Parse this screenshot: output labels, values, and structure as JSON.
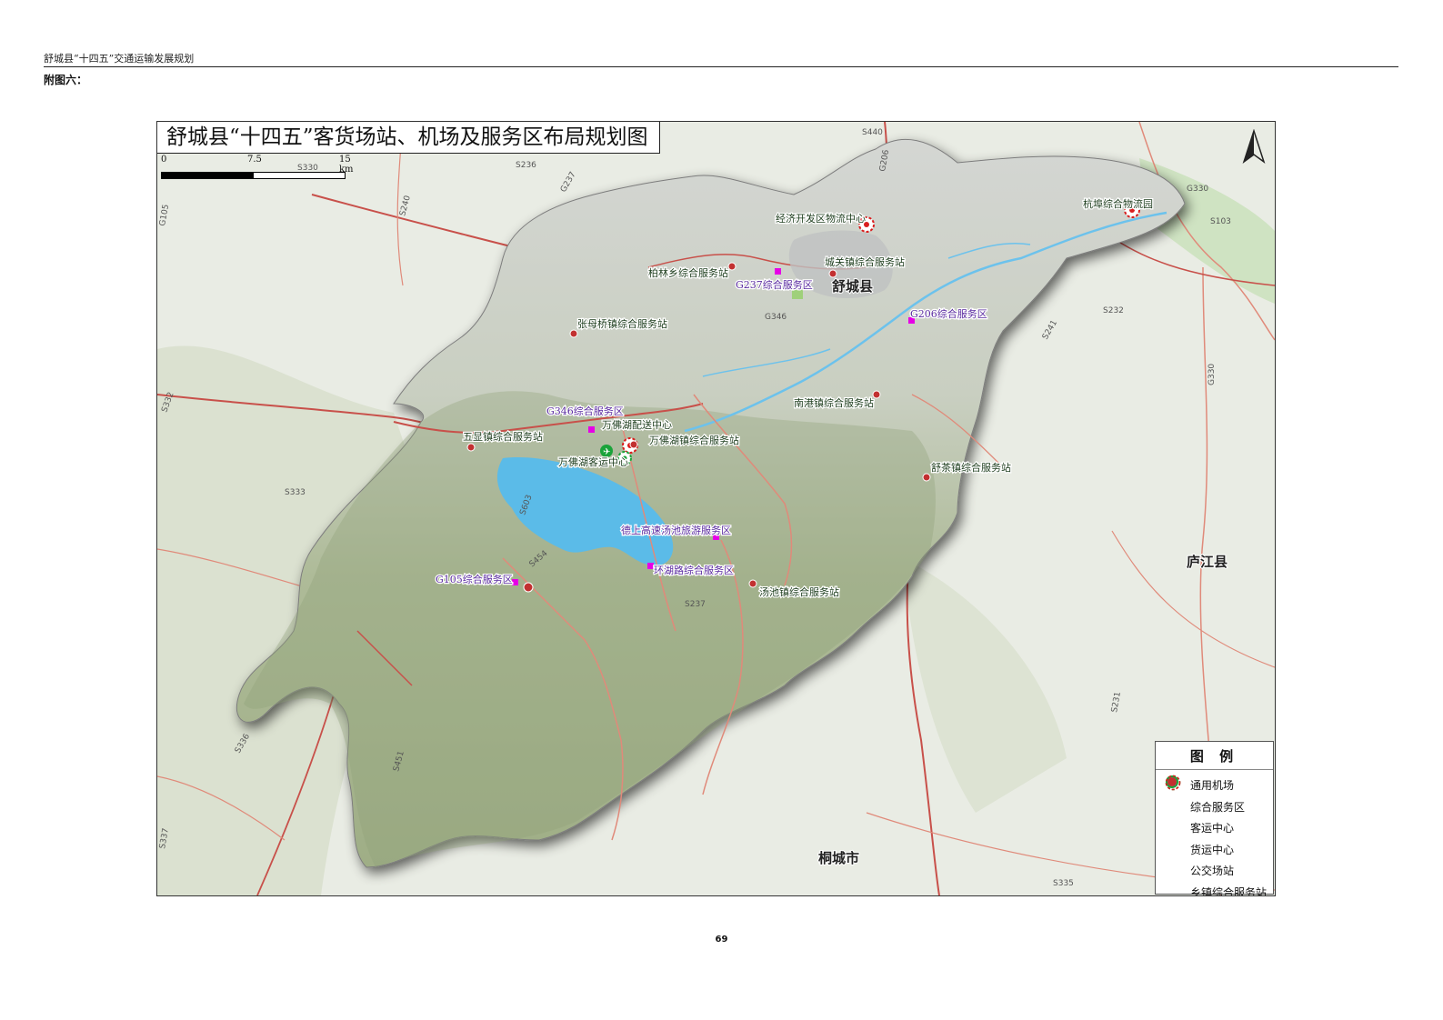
{
  "document": {
    "header": "舒城县“十四五”交通运输发展规划",
    "appendix_label": "附图六：",
    "page_number": "69"
  },
  "map": {
    "title": "舒城县“十四五”客货场站、机场及服务区布局规划图",
    "scale": {
      "ticks": [
        "0",
        "7.5",
        "15 km"
      ]
    },
    "north_arrow_icon": "north-arrow-icon",
    "counties": [
      "舒城县",
      "庐江县",
      "桐城市"
    ],
    "roads": [
      "S440",
      "G206",
      "S330",
      "S236",
      "G237",
      "S240",
      "G105",
      "S103",
      "G330",
      "S232",
      "G346",
      "S241",
      "G330",
      "S332",
      "S333",
      "S603",
      "S454",
      "S451",
      "S336",
      "S337",
      "S231",
      "S335",
      "S237"
    ],
    "stations": [
      {
        "label": "经济开发区物流中心",
        "type": "freight"
      },
      {
        "label": "杭埠综合物流园",
        "type": "freight"
      },
      {
        "label": "柏林乡综合服务站",
        "type": "township"
      },
      {
        "label": "城关镇综合服务站",
        "type": "township"
      },
      {
        "label": "张母桥镇综合服务站",
        "type": "township"
      },
      {
        "label": "南港镇综合服务站",
        "type": "township"
      },
      {
        "label": "五显镇综合服务站",
        "type": "township"
      },
      {
        "label": "万佛湖配送中心",
        "type": "freight"
      },
      {
        "label": "万佛湖镇综合服务站",
        "type": "township"
      },
      {
        "label": "万佛湖客运中心",
        "type": "passenger"
      },
      {
        "label": "舒茶镇综合服务站",
        "type": "township"
      },
      {
        "label": "汤池镇综合服务站",
        "type": "township"
      }
    ],
    "service_areas": [
      "G237综合服务区",
      "G206综合服务区",
      "G346综合服务区",
      "德上高速汤池旅游服务区",
      "环湖路综合服务区",
      "G105综合服务区"
    ],
    "airport_label": "通用机场"
  },
  "legend": {
    "title": "图 例",
    "items": [
      {
        "label": "通用机场",
        "icon": "airport-icon"
      },
      {
        "label": "综合服务区",
        "icon": "service-area-square-icon",
        "color": "#e600e6"
      },
      {
        "label": "客运中心",
        "icon": "passenger-hub-icon",
        "color": "#1aa33a"
      },
      {
        "label": "货运中心",
        "icon": "freight-hub-icon",
        "color": "#d91e1e"
      },
      {
        "label": "公交场站",
        "icon": "bus-station-icon",
        "color": "#4cc08a"
      },
      {
        "label": "乡镇综合服务站",
        "icon": "township-station-icon",
        "color": "#c23030"
      }
    ]
  },
  "colors": {
    "county_fill": "#cfd0d0",
    "water": "#5bbbe8",
    "national_road": "#c8504a",
    "provincial_road": "#e08a7a"
  }
}
